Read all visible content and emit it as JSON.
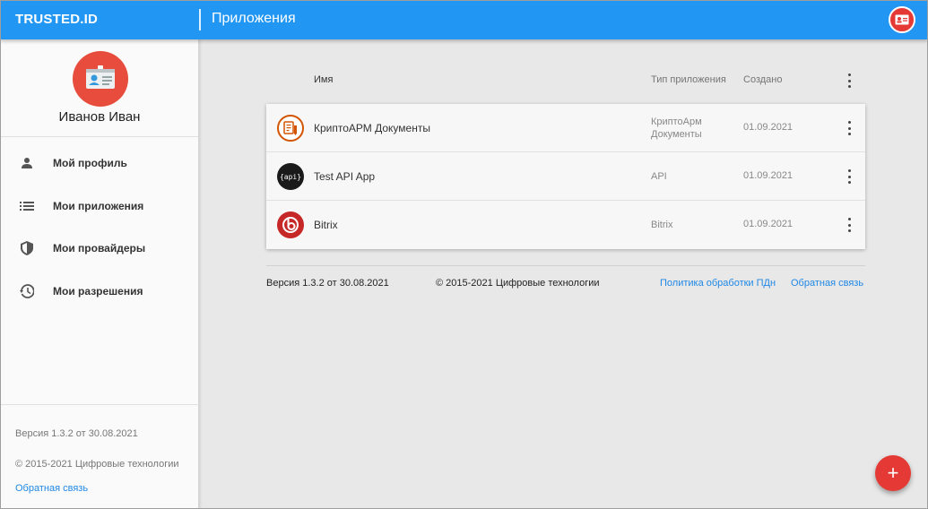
{
  "header": {
    "brand": "TRUSTED.ID",
    "title": "Приложения",
    "avatar_icon": "id-card-icon"
  },
  "sidebar": {
    "user_name": "Иванов Иван",
    "items": [
      {
        "label": "Мой профиль",
        "icon": "person-icon"
      },
      {
        "label": "Мои приложения",
        "icon": "list-icon"
      },
      {
        "label": "Мои провайдеры",
        "icon": "shield-icon"
      },
      {
        "label": "Мои разрешения",
        "icon": "history-icon"
      }
    ],
    "footer": {
      "version": "Версия 1.3.2 от 30.08.2021",
      "copyright": "© 2015-2021 Цифровые технологии",
      "feedback": "Обратная связь"
    }
  },
  "table": {
    "headers": {
      "name": "Имя",
      "type": "Тип приложения",
      "created": "Создано"
    },
    "rows": [
      {
        "name": "КриптоАРМ Документы",
        "type": "КриптоАрм Документы",
        "created": "01.09.2021",
        "icon": "document-pen-icon",
        "icon_color": "#d35400"
      },
      {
        "name": "Test API App",
        "type": "API",
        "created": "01.09.2021",
        "icon": "api-icon",
        "icon_text": "{api}",
        "icon_color": "#1a1a1a"
      },
      {
        "name": "Bitrix",
        "type": "Bitrix",
        "created": "01.09.2021",
        "icon": "bitrix-icon",
        "icon_color": "#c62828"
      }
    ]
  },
  "footer": {
    "version": "Версия 1.3.2 от 30.08.2021",
    "copyright": "© 2015-2021 Цифровые технологии",
    "policy": "Политика обработки ПДн",
    "feedback": "Обратная связь"
  },
  "fab": {
    "label": "+"
  },
  "colors": {
    "primary": "#2196f3",
    "accent": "#e53935",
    "link": "#1e88e5"
  }
}
